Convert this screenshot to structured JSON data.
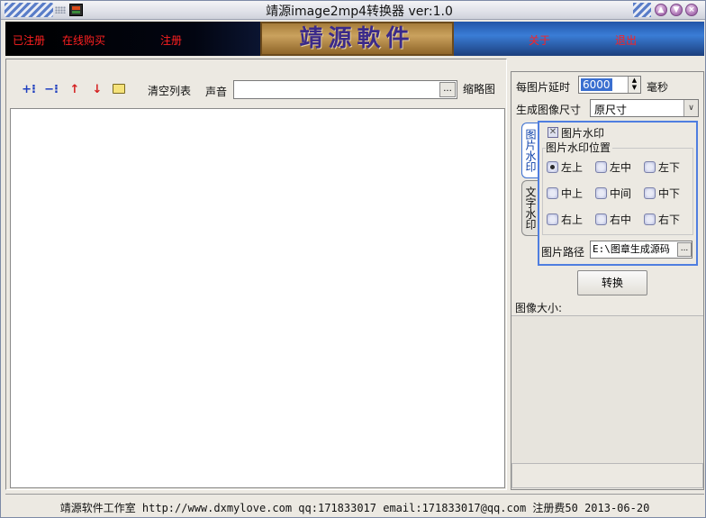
{
  "window": {
    "title": "靖源image2mp4转换器 ver:1.0"
  },
  "banner": {
    "links": [
      "已注册",
      "在线购买",
      "注册",
      "关于",
      "退出"
    ],
    "logo_text": "靖源軟件"
  },
  "toolbar": {
    "clear_label": "清空列表",
    "sound_label": "声音",
    "sound_value": "",
    "browse_label": "...",
    "thumbnail_label": "缩略图"
  },
  "settings": {
    "delay_label": "每图片延时",
    "delay_value": "6000",
    "delay_unit": "毫秒",
    "size_label": "生成图像尺寸",
    "size_value": "原尺寸"
  },
  "tabs": {
    "image_watermark": "图片水印",
    "text_watermark": "文字水印"
  },
  "watermark": {
    "enable_label": "图片水印",
    "position_group": "图片水印位置",
    "positions": [
      "左上",
      "左中",
      "左下",
      "中上",
      "中间",
      "中下",
      "右上",
      "右中",
      "右下"
    ],
    "selected": "左上",
    "path_label": "图片路径",
    "path_value": "E:\\图章生成源码",
    "path_button": "..."
  },
  "convert_button": "转换",
  "image_size_label": "图像大小:",
  "footer": "靖源软件工作室 http://www.dxmylove.com qq:171833017 email:171833017@qq.com 注册费50 2013-06-20",
  "colors": {
    "banner_link": "#ff2020",
    "accent": "#3a6fd0"
  }
}
